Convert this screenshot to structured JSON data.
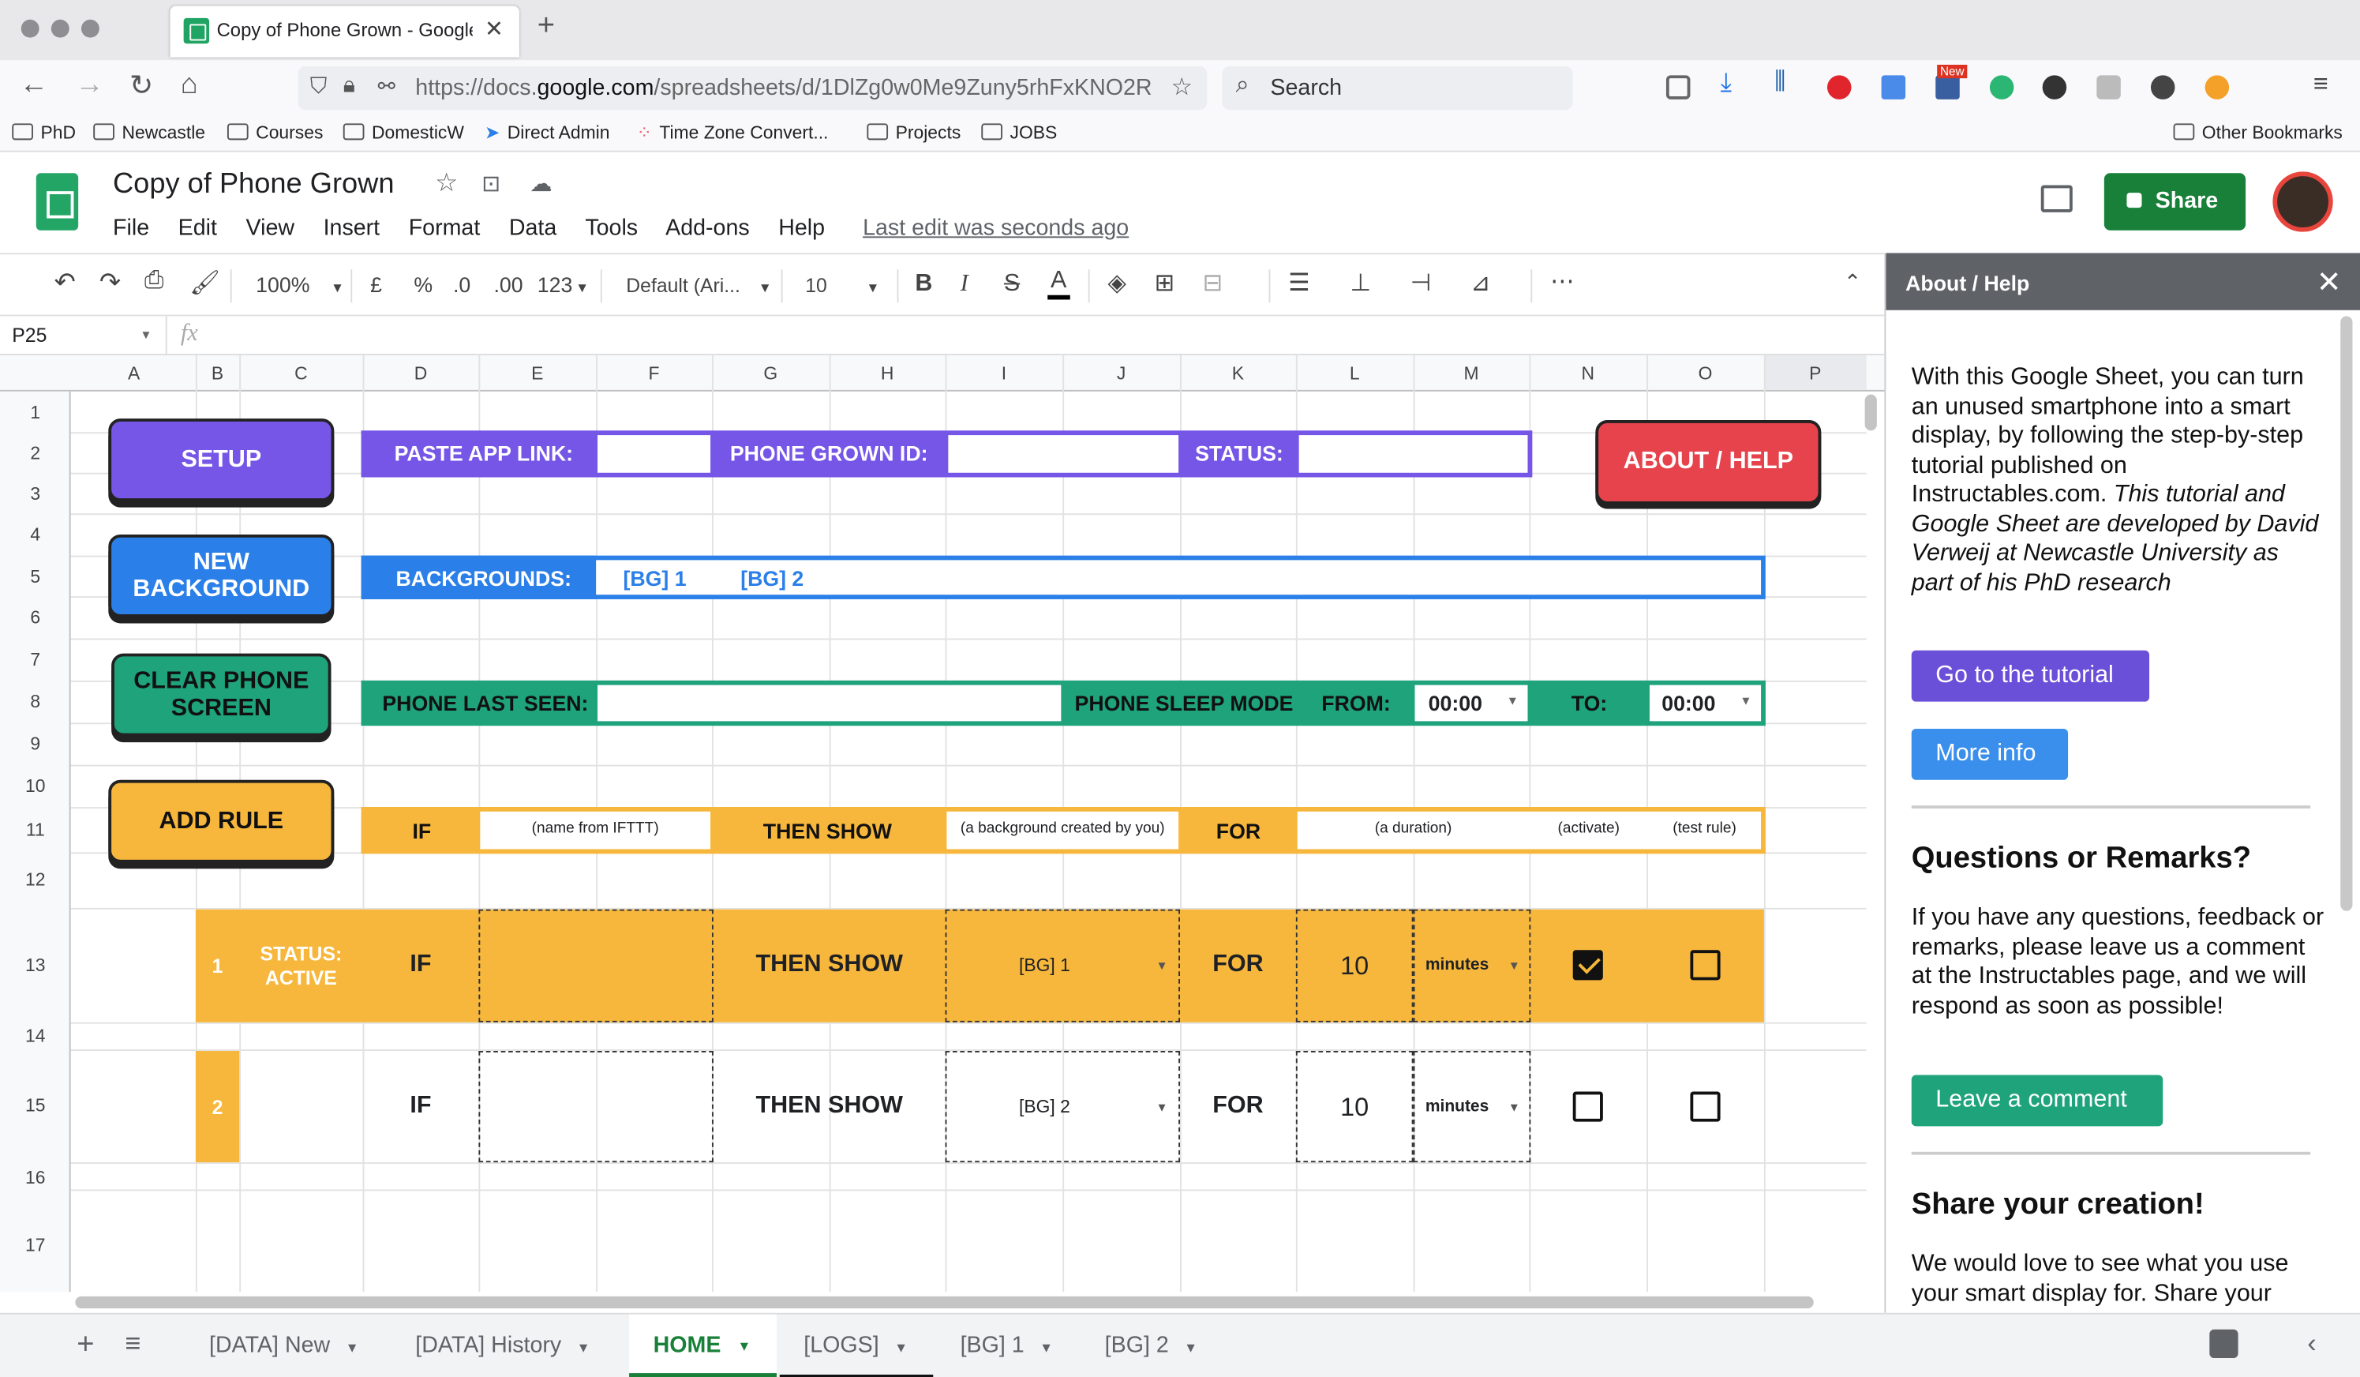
{
  "browser": {
    "tab_title": "Copy of Phone Grown - Google S",
    "url_prefix": "https://docs.",
    "url_domain": "google.com",
    "url_rest": "/spreadsheets/d/1DlZg0w0Me9Zuny5rhFxKNO2R",
    "search_placeholder": "Search",
    "bookmarks": [
      "PhD",
      "Newcastle",
      "Courses",
      "DomesticW",
      "Direct Admin",
      "Time Zone Convert...",
      "Projects",
      "JOBS"
    ],
    "other_bookmarks": "Other Bookmarks",
    "new_badge": "New"
  },
  "doc": {
    "title": "Copy of Phone Grown",
    "menus": [
      "File",
      "Edit",
      "View",
      "Insert",
      "Format",
      "Data",
      "Tools",
      "Add-ons",
      "Help"
    ],
    "last_edit": "Last edit was seconds ago",
    "share": "Share"
  },
  "toolbar": {
    "zoom": "100%",
    "currency": "£",
    "percent": "%",
    "dec_less": ".0",
    "dec_more": ".00",
    "number_format": "123",
    "font": "Default (Ari...",
    "font_size": "10",
    "bold": "B",
    "italic": "I",
    "strike": "S",
    "text_color": "A"
  },
  "formula_bar": {
    "cell": "P25",
    "fx": "fx"
  },
  "columns": [
    "A",
    "B",
    "C",
    "D",
    "E",
    "F",
    "G",
    "H",
    "I",
    "J",
    "K",
    "L",
    "M",
    "N",
    "O",
    "P"
  ],
  "rows": [
    "1",
    "2",
    "3",
    "4",
    "5",
    "6",
    "7",
    "8",
    "9",
    "10",
    "11",
    "12",
    "13",
    "14",
    "15",
    "16",
    "17"
  ],
  "sheet": {
    "buttons": {
      "setup": "SETUP",
      "new_background_1": "NEW",
      "new_background_2": "BACKGROUND",
      "clear_1": "CLEAR PHONE",
      "clear_2": "SCREEN",
      "add_rule": "ADD RULE",
      "about": "ABOUT / HELP"
    },
    "row2": {
      "paste_app_link": "PASTE APP LINK:",
      "phone_grown_id": "PHONE GROWN ID:",
      "status": "STATUS:"
    },
    "row5": {
      "backgrounds": "BACKGROUNDS:",
      "bg1": "[BG] 1",
      "bg2": "[BG] 2"
    },
    "row8": {
      "last_seen": "PHONE LAST SEEN:",
      "sleep_mode": "PHONE SLEEP MODE",
      "from": "FROM:",
      "from_val": "00:00",
      "to": "TO:",
      "to_val": "00:00"
    },
    "row11": {
      "if": "IF",
      "name_hint": "(name from IFTTT)",
      "then_show": "THEN SHOW",
      "bg_hint": "(a background created by you)",
      "for": "FOR",
      "duration_hint": "(a duration)",
      "activate_hint": "(activate)",
      "test_hint": "(test rule)"
    },
    "rules": [
      {
        "num": "1",
        "status_1": "STATUS:",
        "status_2": "ACTIVE",
        "if": "IF",
        "then_show": "THEN SHOW",
        "bg": "[BG] 1",
        "for": "FOR",
        "duration": "10",
        "unit": "minutes",
        "active": true,
        "test": false
      },
      {
        "num": "2",
        "status_1": "",
        "status_2": "",
        "if": "IF",
        "then_show": "THEN SHOW",
        "bg": "[BG] 2",
        "for": "FOR",
        "duration": "10",
        "unit": "minutes",
        "active": false,
        "test": false
      }
    ]
  },
  "panel": {
    "title": "About / Help",
    "intro_plain": "With this Google Sheet, you can turn an unused smartphone into a smart display, by following the step-by-step tutorial published on Instructables.com. ",
    "intro_italic": "This tutorial and Google Sheet are developed by David Verweij at Newcastle University as part of his PhD research",
    "tutorial_btn": "Go to the tutorial",
    "more_info_btn": "More info",
    "questions_heading": "Questions or Remarks?",
    "questions_text": "If you have any questions, feedback or remarks, please leave us a comment at the Instructables page, and we will respond as soon as possible!",
    "comment_btn": "Leave a comment",
    "share_heading": "Share your creation!",
    "share_text": "We would love to see what you use your smart display for. Share your"
  },
  "sheet_tabs": [
    "[DATA] New",
    "[DATA] History",
    "HOME",
    "[LOGS]",
    "[BG] 1",
    "[BG] 2"
  ],
  "colors": {
    "purple": "#7656e6",
    "blue": "#2a7fe8",
    "green": "#1ea37a",
    "yellow": "#f6b73c",
    "red": "#e6434c",
    "sheets_green": "#188038"
  }
}
